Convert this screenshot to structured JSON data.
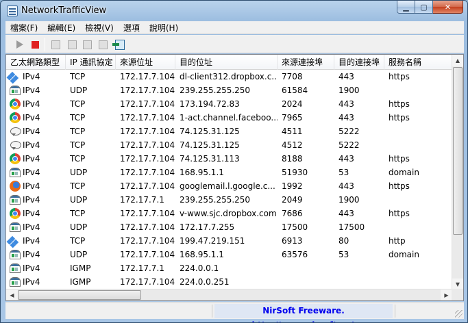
{
  "window": {
    "title": "NetworkTrafficView"
  },
  "menu": [
    "檔案(F)",
    "編輯(E)",
    "檢視(V)",
    "選項",
    "說明(H)"
  ],
  "toolbar": {
    "buttons": [
      {
        "name": "start-capture-button",
        "icon": "play-icon"
      },
      {
        "name": "stop-capture-button",
        "icon": "stop-icon"
      },
      {
        "name": "save-button",
        "icon": "save-icon"
      },
      {
        "name": "copy-button",
        "icon": "copy-icon"
      },
      {
        "name": "properties-button",
        "icon": "properties-icon"
      },
      {
        "name": "find-button",
        "icon": "find-icon"
      },
      {
        "name": "exit-button",
        "icon": "exit-icon"
      }
    ]
  },
  "table": {
    "columns": [
      "乙太網路類型",
      "IP 通訊協定",
      "來源位址",
      "目的位址",
      "來源連接埠",
      "目的連接埠",
      "服務名稱"
    ],
    "rows": [
      {
        "icon": "dropbox",
        "c": [
          "IPv4",
          "TCP",
          "172.17.7.104",
          "dl-client312.dropbox.c...",
          "7708",
          "443",
          "https"
        ]
      },
      {
        "icon": "window",
        "c": [
          "IPv4",
          "UDP",
          "172.17.7.104",
          "239.255.255.250",
          "61584",
          "1900",
          ""
        ]
      },
      {
        "icon": "chrome",
        "c": [
          "IPv4",
          "TCP",
          "172.17.7.104",
          "173.194.72.83",
          "2024",
          "443",
          "https"
        ]
      },
      {
        "icon": "chrome",
        "c": [
          "IPv4",
          "TCP",
          "172.17.7.104",
          "1-act.channel.faceboo...",
          "7965",
          "443",
          "https"
        ]
      },
      {
        "icon": "chat",
        "c": [
          "IPv4",
          "TCP",
          "172.17.7.104",
          "74.125.31.125",
          "4511",
          "5222",
          ""
        ]
      },
      {
        "icon": "chat",
        "c": [
          "IPv4",
          "TCP",
          "172.17.7.104",
          "74.125.31.125",
          "4512",
          "5222",
          ""
        ]
      },
      {
        "icon": "chrome",
        "c": [
          "IPv4",
          "TCP",
          "172.17.7.104",
          "74.125.31.113",
          "8188",
          "443",
          "https"
        ]
      },
      {
        "icon": "window",
        "c": [
          "IPv4",
          "UDP",
          "172.17.7.104",
          "168.95.1.1",
          "51930",
          "53",
          "domain"
        ]
      },
      {
        "icon": "firefox",
        "c": [
          "IPv4",
          "TCP",
          "172.17.7.104",
          "googlemail.l.google.c...",
          "1992",
          "443",
          "https"
        ]
      },
      {
        "icon": "window",
        "c": [
          "IPv4",
          "UDP",
          "172.17.7.1",
          "239.255.255.250",
          "2049",
          "1900",
          ""
        ]
      },
      {
        "icon": "chrome",
        "c": [
          "IPv4",
          "TCP",
          "172.17.7.104",
          "v-www.sjc.dropbox.com",
          "7686",
          "443",
          "https"
        ]
      },
      {
        "icon": "window",
        "c": [
          "IPv4",
          "UDP",
          "172.17.7.104",
          "172.17.7.255",
          "17500",
          "17500",
          ""
        ]
      },
      {
        "icon": "dropbox",
        "c": [
          "IPv4",
          "TCP",
          "172.17.7.104",
          "199.47.219.151",
          "6913",
          "80",
          "http"
        ]
      },
      {
        "icon": "window",
        "c": [
          "IPv4",
          "UDP",
          "172.17.7.104",
          "168.95.1.1",
          "63576",
          "53",
          "domain"
        ]
      },
      {
        "icon": "window",
        "c": [
          "IPv4",
          "IGMP",
          "172.17.7.1",
          "224.0.0.1",
          "",
          "",
          ""
        ]
      },
      {
        "icon": "window",
        "c": [
          "IPv4",
          "IGMP",
          "172.17.7.104",
          "224.0.0.251",
          "",
          "",
          ""
        ]
      }
    ]
  },
  "status": {
    "credit": "NirSoft Freeware.  http://www.nirsoft.net"
  }
}
